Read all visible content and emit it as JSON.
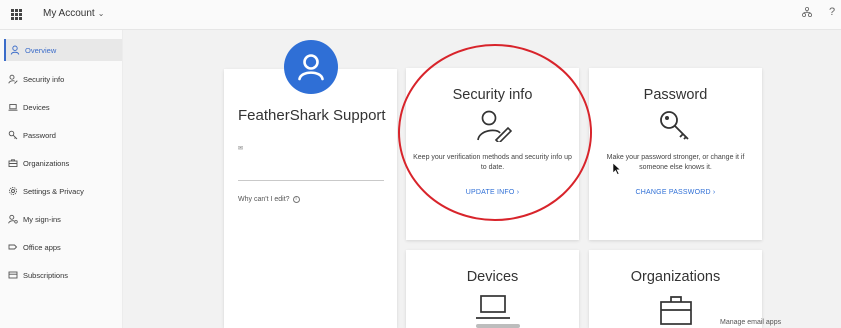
{
  "header": {
    "app_title": "My Account",
    "help_label": "?"
  },
  "sidebar": {
    "items": [
      {
        "label": "Overview",
        "icon": "person-icon",
        "active": true
      },
      {
        "label": "Security info",
        "icon": "security-info-icon"
      },
      {
        "label": "Devices",
        "icon": "laptop-icon"
      },
      {
        "label": "Password",
        "icon": "key-icon"
      },
      {
        "label": "Organizations",
        "icon": "briefcase-icon"
      },
      {
        "label": "Settings & Privacy",
        "icon": "gear-icon"
      },
      {
        "label": "My sign-ins",
        "icon": "sign-ins-icon"
      },
      {
        "label": "Office apps",
        "icon": "office-apps-icon"
      },
      {
        "label": "Subscriptions",
        "icon": "subscriptions-icon"
      }
    ]
  },
  "profile": {
    "name": "FeatherShark Support",
    "edit_question": "Why can't I edit?"
  },
  "cards": {
    "security": {
      "title": "Security info",
      "description": "Keep your verification methods and security info up to date.",
      "link": "UPDATE INFO"
    },
    "password": {
      "title": "Password",
      "description": "Make your password stronger, or change it if someone else knows it.",
      "link": "CHANGE PASSWORD"
    },
    "devices": {
      "title": "Devices"
    },
    "organizations": {
      "title": "Organizations"
    }
  },
  "footer": {
    "manage_email": "Manage email apps"
  },
  "colors": {
    "accent": "#2f6fd6",
    "highlight": "#d8242b"
  }
}
